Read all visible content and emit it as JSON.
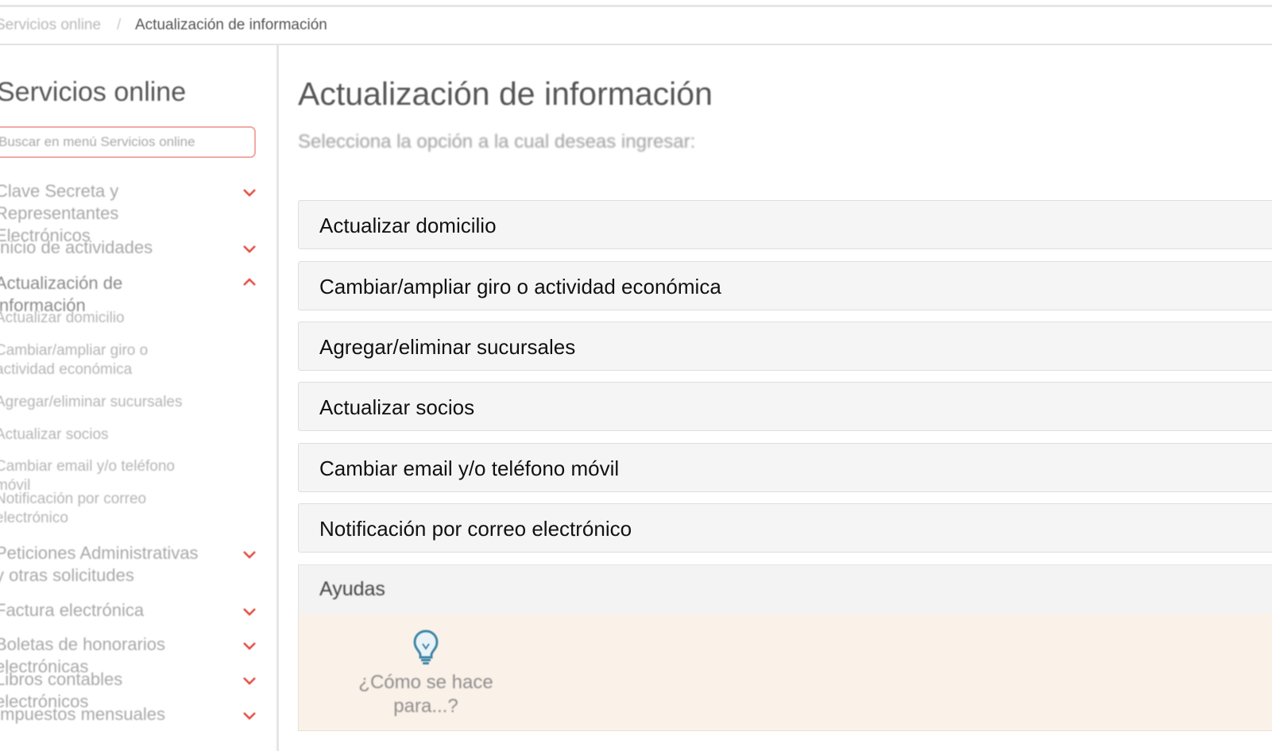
{
  "breadcrumb": {
    "previous": "Servicios online",
    "separator": "/",
    "current": "Actualización de información"
  },
  "sidebar": {
    "title": "Servicios online",
    "search_placeholder": "Buscar en menú Servicios online",
    "items": [
      {
        "label": "Clave Secreta y Representantes Electrónicos",
        "expanded": false
      },
      {
        "label": "Inicio de actividades",
        "expanded": false
      },
      {
        "label": "Actualización de información",
        "expanded": true,
        "children": [
          "Actualizar domicilio",
          "Cambiar/ampliar giro o actividad económica",
          "Agregar/eliminar sucursales",
          "Actualizar socios",
          "Cambiar email y/o teléfono móvil",
          "Notificación por correo electrónico"
        ]
      },
      {
        "label": "Peticiones Administrativas y otras solicitudes",
        "expanded": false
      },
      {
        "label": "Factura electrónica",
        "expanded": false
      },
      {
        "label": "Boletas de honorarios electrónicas",
        "expanded": false
      },
      {
        "label": "Libros contables electrónicos",
        "expanded": false
      },
      {
        "label": "Impuestos mensuales",
        "expanded": false
      }
    ]
  },
  "main": {
    "title": "Actualización de información",
    "subtitle": "Selecciona la opción a la cual deseas ingresar:",
    "options": [
      "Actualizar domicilio",
      "Cambiar/ampliar giro o actividad económica",
      "Agregar/eliminar sucursales",
      "Actualizar socios",
      "Cambiar email y/o teléfono móvil",
      "Notificación por correo electrónico"
    ],
    "help": {
      "heading": "Ayudas",
      "link_label": "¿Cómo se hace para...?",
      "icon": "lightbulb-icon"
    }
  },
  "colors": {
    "accent": "#e0453a",
    "help_background": "#faf1e8",
    "option_background": "#f5f5f5",
    "bulb": "#3f87a8"
  }
}
